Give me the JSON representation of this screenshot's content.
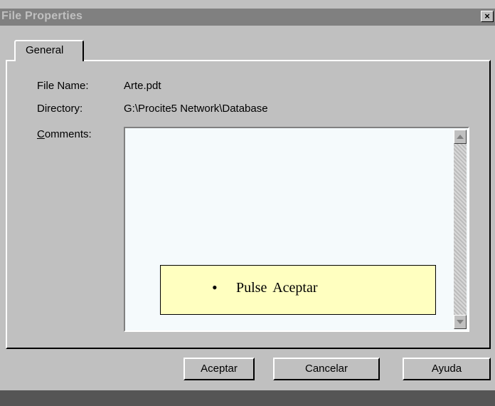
{
  "window": {
    "title": "File Properties",
    "close_glyph": "×"
  },
  "tabs": [
    {
      "label": "General"
    }
  ],
  "fields": {
    "file_name_label": "File Name:",
    "file_name_value": "Arte.pdt",
    "directory_label": "Directory:",
    "directory_value": "G:\\Procite5 Network\\Database",
    "comments_label_accel": "C",
    "comments_label_rest": "omments:",
    "comments_value": ""
  },
  "callout": {
    "bullet": "•",
    "text": "Pulse Aceptar"
  },
  "buttons": {
    "ok": "Aceptar",
    "cancel": "Cancelar",
    "help": "Ayuda"
  },
  "colors": {
    "callout_bg": "#ffffc0",
    "titlebar_bg": "#808080",
    "dialog_bg": "#c0c0c0"
  }
}
